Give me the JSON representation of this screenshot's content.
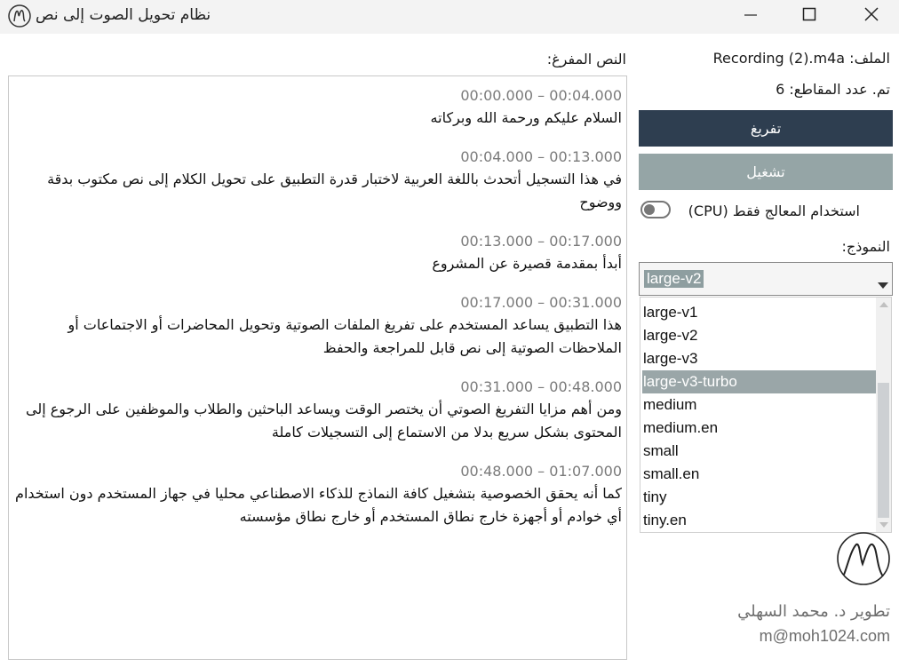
{
  "window": {
    "title": "نظام تحويل الصوت إلى نص",
    "logo_icon": "m-signature-icon",
    "controls": [
      "minimize-icon",
      "maximize-icon",
      "close-icon"
    ]
  },
  "transcript": {
    "label": "النص المفرغ:",
    "segments": [
      {
        "time": "00:00.000 – 00:04.000",
        "text": "السلام عليكم ورحمة الله وبركاته"
      },
      {
        "time": "00:04.000 – 00:13.000",
        "text": "في هذا التسجيل أتحدث باللغة العربية لاختبار قدرة التطبيق على تحويل الكلام إلى نص مكتوب بدقة ووضوح"
      },
      {
        "time": "00:13.000 – 00:17.000",
        "text": "أبدأ بمقدمة قصيرة عن المشروع"
      },
      {
        "time": "00:17.000 – 00:31.000",
        "text": "هذا التطبيق يساعد المستخدم على تفريغ الملفات الصوتية وتحويل المحاضرات أو الاجتماعات أو الملاحظات الصوتية إلى نص قابل للمراجعة والحفظ"
      },
      {
        "time": "00:31.000 – 00:48.000",
        "text": "ومن أهم مزايا التفريغ الصوتي أن يختصر الوقت ويساعد الباحثين والطلاب والموظفين على الرجوع إلى المحتوى بشكل سريع بدلا من الاستماع إلى التسجيلات كاملة"
      },
      {
        "time": "00:48.000 – 01:07.000",
        "text": "كما أنه يحقق الخصوصية بتشغيل كافة النماذج للذكاء الاصطناعي محليا في جهاز المستخدم دون استخدام أي خوادم أو أجهزة خارج نطاق المستخدم أو خارج نطاق مؤسسته"
      }
    ]
  },
  "side": {
    "file_line": "الملف: Recording (2).m4a",
    "status_line": "تم. عدد المقاطع: 6",
    "transcribe_label": "تفريغ",
    "run_label": "تشغيل",
    "cpu_label": "استخدام المعالج فقط (CPU)",
    "cpu_enabled": false,
    "model_label": "النموذج:",
    "model_selected": "large-v2",
    "model_options": [
      "large-v1",
      "large-v2",
      "large-v3",
      "large-v3-turbo",
      "medium",
      "medium.en",
      "small",
      "small.en",
      "tiny",
      "tiny.en"
    ],
    "highlighted_option": "large-v3-turbo",
    "developer": "تطوير د. محمد السهلي",
    "email": "m@moh1024.com"
  },
  "colors": {
    "primary_button": "#2e3e50",
    "secondary_button": "#95a5a6",
    "selection": "#9aa6a8"
  }
}
